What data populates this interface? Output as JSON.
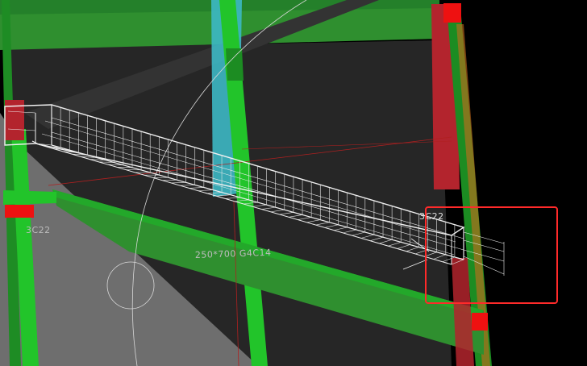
{
  "viewport": {
    "background": "#000000",
    "floor_color": "#262626",
    "slab_color": "#6e6e6e"
  },
  "colors": {
    "column_green": "#22c42a",
    "beam_green": "#2f8f2f",
    "beam_dark_green": "#1f6e1f",
    "column_red": "#b3242d",
    "cap_red": "#ee1111",
    "column_cyan": "#3db8c4",
    "rebar_white": "#f0f0f0",
    "grid_red": "#b02020",
    "highlight_red": "#ff2a2a",
    "label_gray": "#bcbcbc"
  },
  "labels": {
    "beam_spec": "250*700 G4C14",
    "column_left": "3C22",
    "column_right": "3C22"
  },
  "highlight_box": {
    "stroke": "#ff2a2a"
  }
}
